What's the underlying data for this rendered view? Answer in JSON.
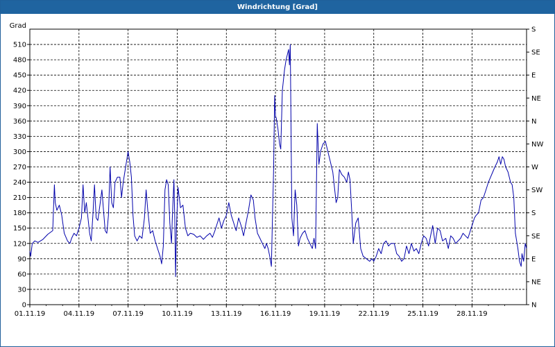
{
  "window": {
    "title": "Windrichtung [Grad]"
  },
  "chart_data": {
    "type": "line",
    "title": "Windrichtung [Grad]",
    "ylabel": "Grad",
    "ylim": [
      0,
      540
    ],
    "yticks": [
      0,
      30,
      60,
      90,
      120,
      150,
      180,
      210,
      240,
      270,
      300,
      330,
      360,
      390,
      420,
      450,
      480,
      510
    ],
    "right_ticks": [
      "N",
      "NE",
      "E",
      "SE",
      "S",
      "SW",
      "W",
      "NW",
      "N",
      "NE",
      "E",
      "SE",
      "S"
    ],
    "xlim": [
      0,
      30.33
    ],
    "x_tick_positions": [
      0,
      3,
      6,
      9,
      12,
      15,
      18,
      21,
      24,
      27
    ],
    "x_tick_labels": [
      "01.11.19",
      "04.11.19",
      "07.11.19",
      "10.11.19",
      "13.11.19",
      "16.11.19",
      "19.11.19",
      "22.11.19",
      "25.11.19",
      "28.11.19"
    ],
    "grid": true,
    "line_color": "#0000aa",
    "series": [
      {
        "points": [
          [
            0.0,
            105
          ],
          [
            0.05,
            95
          ],
          [
            0.15,
            120
          ],
          [
            0.3,
            125
          ],
          [
            0.5,
            122
          ],
          [
            0.8,
            128
          ],
          [
            1.1,
            138
          ],
          [
            1.4,
            145
          ],
          [
            1.5,
            235
          ],
          [
            1.55,
            200
          ],
          [
            1.65,
            185
          ],
          [
            1.8,
            195
          ],
          [
            1.95,
            175
          ],
          [
            2.1,
            140
          ],
          [
            2.3,
            125
          ],
          [
            2.45,
            120
          ],
          [
            2.55,
            130
          ],
          [
            2.7,
            140
          ],
          [
            2.85,
            135
          ],
          [
            3.0,
            150
          ],
          [
            3.15,
            170
          ],
          [
            3.25,
            235
          ],
          [
            3.35,
            180
          ],
          [
            3.45,
            200
          ],
          [
            3.55,
            170
          ],
          [
            3.65,
            140
          ],
          [
            3.75,
            125
          ],
          [
            3.85,
            175
          ],
          [
            3.95,
            235
          ],
          [
            4.05,
            170
          ],
          [
            4.15,
            165
          ],
          [
            4.3,
            200
          ],
          [
            4.4,
            225
          ],
          [
            4.5,
            185
          ],
          [
            4.6,
            145
          ],
          [
            4.7,
            140
          ],
          [
            4.8,
            175
          ],
          [
            4.9,
            270
          ],
          [
            5.0,
            200
          ],
          [
            5.1,
            190
          ],
          [
            5.2,
            240
          ],
          [
            5.35,
            250
          ],
          [
            5.5,
            250
          ],
          [
            5.6,
            210
          ],
          [
            5.7,
            240
          ],
          [
            5.85,
            270
          ],
          [
            6.0,
            300
          ],
          [
            6.1,
            280
          ],
          [
            6.2,
            250
          ],
          [
            6.3,
            175
          ],
          [
            6.4,
            135
          ],
          [
            6.55,
            125
          ],
          [
            6.7,
            135
          ],
          [
            6.85,
            130
          ],
          [
            7.0,
            170
          ],
          [
            7.1,
            225
          ],
          [
            7.2,
            185
          ],
          [
            7.35,
            140
          ],
          [
            7.5,
            145
          ],
          [
            7.65,
            125
          ],
          [
            7.8,
            110
          ],
          [
            7.95,
            95
          ],
          [
            8.05,
            80
          ],
          [
            8.15,
            115
          ],
          [
            8.25,
            225
          ],
          [
            8.35,
            245
          ],
          [
            8.45,
            235
          ],
          [
            8.55,
            160
          ],
          [
            8.65,
            120
          ],
          [
            8.7,
            170
          ],
          [
            8.8,
            245
          ],
          [
            8.85,
            170
          ],
          [
            8.9,
            55
          ],
          [
            8.95,
            150
          ],
          [
            9.05,
            230
          ],
          [
            9.2,
            190
          ],
          [
            9.35,
            195
          ],
          [
            9.5,
            150
          ],
          [
            9.65,
            135
          ],
          [
            9.8,
            140
          ],
          [
            10.0,
            138
          ],
          [
            10.2,
            132
          ],
          [
            10.4,
            135
          ],
          [
            10.6,
            128
          ],
          [
            10.8,
            135
          ],
          [
            11.0,
            140
          ],
          [
            11.15,
            132
          ],
          [
            11.3,
            145
          ],
          [
            11.45,
            160
          ],
          [
            11.55,
            170
          ],
          [
            11.7,
            150
          ],
          [
            11.85,
            165
          ],
          [
            12.0,
            175
          ],
          [
            12.15,
            200
          ],
          [
            12.3,
            175
          ],
          [
            12.45,
            160
          ],
          [
            12.6,
            145
          ],
          [
            12.75,
            170
          ],
          [
            12.9,
            155
          ],
          [
            13.05,
            135
          ],
          [
            13.2,
            160
          ],
          [
            13.35,
            185
          ],
          [
            13.5,
            215
          ],
          [
            13.65,
            205
          ],
          [
            13.75,
            170
          ],
          [
            13.9,
            140
          ],
          [
            14.05,
            130
          ],
          [
            14.2,
            120
          ],
          [
            14.35,
            110
          ],
          [
            14.45,
            120
          ],
          [
            14.55,
            110
          ],
          [
            14.65,
            95
          ],
          [
            14.75,
            75
          ],
          [
            14.8,
            150
          ],
          [
            14.88,
            260
          ],
          [
            14.95,
            410
          ],
          [
            15.0,
            370
          ],
          [
            15.05,
            365
          ],
          [
            15.15,
            345
          ],
          [
            15.25,
            315
          ],
          [
            15.32,
            305
          ],
          [
            15.42,
            420
          ],
          [
            15.55,
            460
          ],
          [
            15.65,
            480
          ],
          [
            15.8,
            500
          ],
          [
            15.85,
            470
          ],
          [
            15.9,
            510
          ],
          [
            16.0,
            170
          ],
          [
            16.1,
            135
          ],
          [
            16.2,
            225
          ],
          [
            16.3,
            195
          ],
          [
            16.4,
            115
          ],
          [
            16.5,
            130
          ],
          [
            16.65,
            140
          ],
          [
            16.8,
            145
          ],
          [
            16.95,
            130
          ],
          [
            17.1,
            120
          ],
          [
            17.25,
            110
          ],
          [
            17.35,
            130
          ],
          [
            17.45,
            110
          ],
          [
            17.55,
            355
          ],
          [
            17.65,
            275
          ],
          [
            17.75,
            300
          ],
          [
            17.9,
            315
          ],
          [
            18.05,
            320
          ],
          [
            18.2,
            300
          ],
          [
            18.35,
            280
          ],
          [
            18.5,
            260
          ],
          [
            18.6,
            230
          ],
          [
            18.7,
            200
          ],
          [
            18.8,
            210
          ],
          [
            18.9,
            265
          ],
          [
            19.05,
            255
          ],
          [
            19.2,
            250
          ],
          [
            19.35,
            240
          ],
          [
            19.45,
            260
          ],
          [
            19.55,
            245
          ],
          [
            19.65,
            185
          ],
          [
            19.75,
            120
          ],
          [
            19.9,
            160
          ],
          [
            20.05,
            170
          ],
          [
            20.2,
            110
          ],
          [
            20.35,
            95
          ],
          [
            20.55,
            90
          ],
          [
            20.75,
            85
          ],
          [
            20.9,
            90
          ],
          [
            21.0,
            85
          ],
          [
            21.15,
            95
          ],
          [
            21.3,
            110
          ],
          [
            21.45,
            100
          ],
          [
            21.6,
            120
          ],
          [
            21.75,
            125
          ],
          [
            21.9,
            115
          ],
          [
            22.05,
            120
          ],
          [
            22.25,
            120
          ],
          [
            22.4,
            100
          ],
          [
            22.55,
            95
          ],
          [
            22.7,
            85
          ],
          [
            22.85,
            90
          ],
          [
            23.0,
            115
          ],
          [
            23.15,
            100
          ],
          [
            23.3,
            120
          ],
          [
            23.45,
            105
          ],
          [
            23.6,
            110
          ],
          [
            23.75,
            100
          ],
          [
            23.9,
            120
          ],
          [
            24.05,
            135
          ],
          [
            24.2,
            130
          ],
          [
            24.35,
            115
          ],
          [
            24.5,
            140
          ],
          [
            24.6,
            155
          ],
          [
            24.75,
            120
          ],
          [
            24.9,
            150
          ],
          [
            25.05,
            145
          ],
          [
            25.2,
            125
          ],
          [
            25.4,
            130
          ],
          [
            25.55,
            110
          ],
          [
            25.7,
            135
          ],
          [
            25.85,
            130
          ],
          [
            26.0,
            120
          ],
          [
            26.15,
            125
          ],
          [
            26.3,
            130
          ],
          [
            26.45,
            140
          ],
          [
            26.6,
            135
          ],
          [
            26.75,
            130
          ],
          [
            26.9,
            145
          ],
          [
            27.05,
            160
          ],
          [
            27.15,
            170
          ],
          [
            27.25,
            175
          ],
          [
            27.4,
            180
          ],
          [
            27.55,
            205
          ],
          [
            27.7,
            210
          ],
          [
            27.85,
            225
          ],
          [
            28.0,
            240
          ],
          [
            28.2,
            255
          ],
          [
            28.4,
            270
          ],
          [
            28.55,
            280
          ],
          [
            28.65,
            290
          ],
          [
            28.75,
            275
          ],
          [
            28.85,
            290
          ],
          [
            28.95,
            285
          ],
          [
            29.05,
            270
          ],
          [
            29.2,
            260
          ],
          [
            29.35,
            240
          ],
          [
            29.45,
            235
          ],
          [
            29.55,
            210
          ],
          [
            29.65,
            140
          ],
          [
            29.8,
            110
          ],
          [
            29.9,
            85
          ],
          [
            30.0,
            75
          ],
          [
            30.05,
            100
          ],
          [
            30.15,
            85
          ],
          [
            30.25,
            120
          ],
          [
            30.33,
            110
          ]
        ]
      }
    ]
  }
}
